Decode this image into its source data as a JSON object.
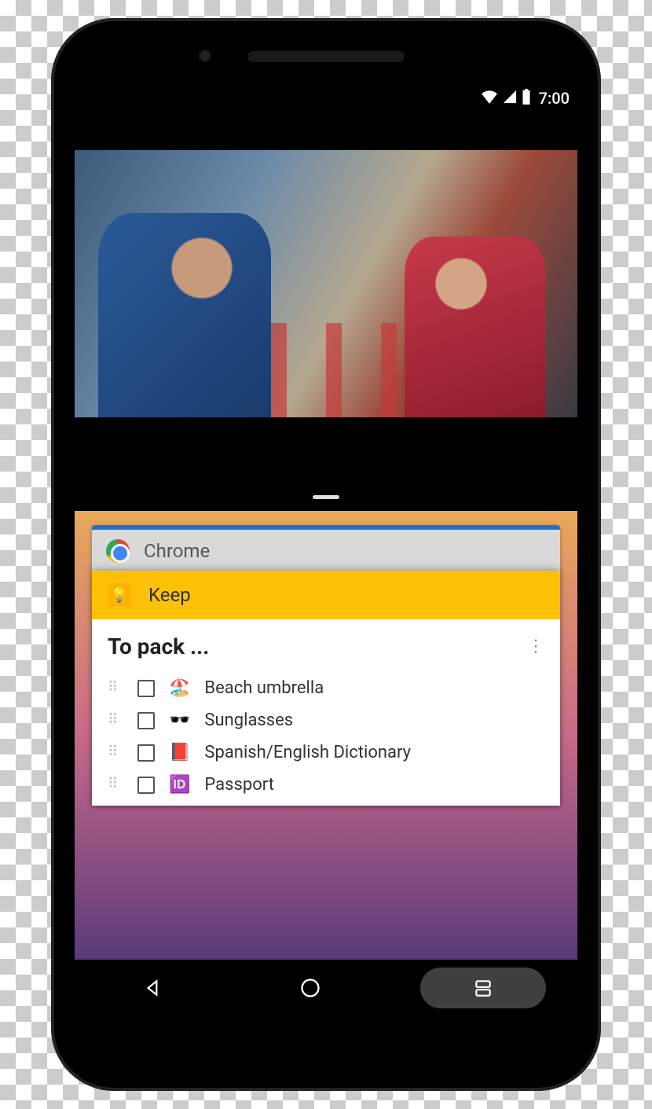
{
  "status_bar": {
    "time": "7:00"
  },
  "split_top": {
    "app": "video-player"
  },
  "recents": {
    "cards": [
      {
        "app_name": "Chrome"
      },
      {
        "app_name": "Keep"
      }
    ]
  },
  "keep_note": {
    "title": "To pack ...",
    "items": [
      {
        "emoji": "🏖️",
        "label": "Beach umbrella"
      },
      {
        "emoji": "🕶️",
        "label": "Sunglasses"
      },
      {
        "emoji": "📕",
        "label": "Spanish/English Dictionary"
      },
      {
        "emoji": "🆔",
        "label": "Passport"
      }
    ]
  },
  "nav": {
    "back": "back",
    "home": "home",
    "recents": "recents"
  }
}
